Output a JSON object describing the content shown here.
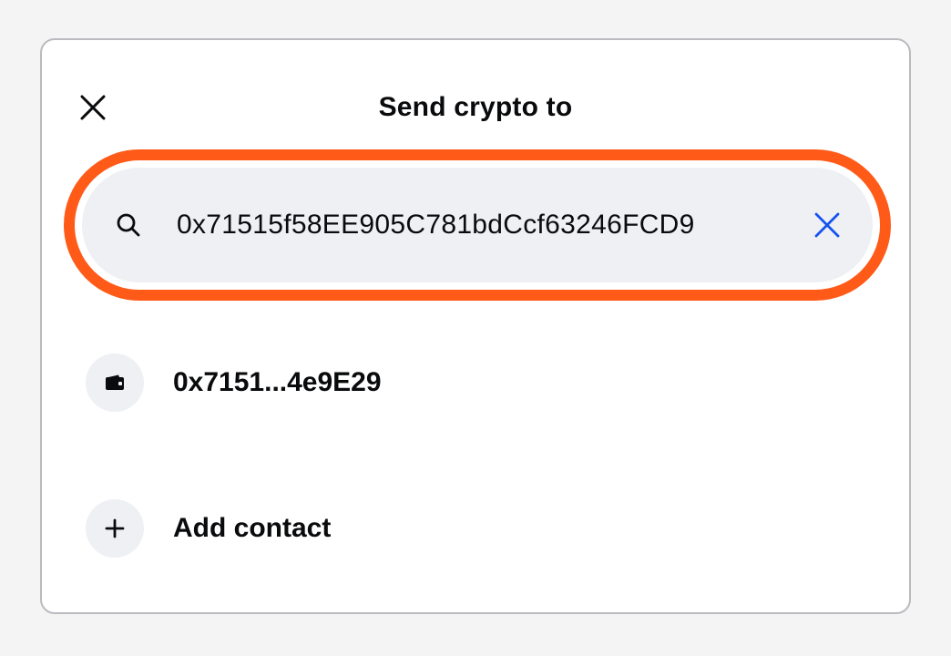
{
  "header": {
    "title": "Send crypto to",
    "close_icon": "close-icon"
  },
  "search": {
    "value": "0x71515f58EE905C781bdCcf63246FCD9",
    "search_icon": "search-icon",
    "clear_icon": "clear-icon",
    "highlight_color": "#ff5a18",
    "clear_icon_color": "#1652f0"
  },
  "results": [
    {
      "label": "0x7151...4e9E29",
      "icon": "wallet-icon"
    }
  ],
  "add_contact": {
    "label": "Add contact",
    "icon": "plus-icon"
  }
}
